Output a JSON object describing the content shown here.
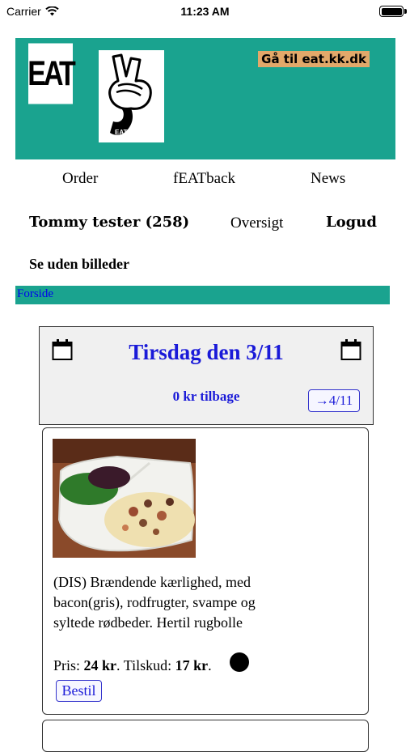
{
  "status_bar": {
    "carrier": "Carrier",
    "time": "11:23 AM",
    "wifi_icon": "wifi-icon",
    "battery_icon": "battery-icon",
    "battery_level": 1.0
  },
  "header": {
    "logo_text": "EAT",
    "mascot_text": "EAT",
    "external_link_label": "Gå til eat.kk.dk",
    "brand_color": "#1aa38f",
    "link_bg_color": "#e2a86a"
  },
  "nav": {
    "order_label": "Order",
    "feedback_label": "fEATback",
    "news_label": "News"
  },
  "user": {
    "name": "Tommy tester (258)",
    "overview_label": "Oversigt",
    "logout_label": "Logud",
    "no_images_label": "Se uden billeder"
  },
  "breadcrumb": {
    "home_label": "Forside"
  },
  "day": {
    "title": "Tirsdag den 3/11",
    "refund": "0 kr tilbage",
    "next_day_label": "→4/11",
    "calendar_icon": "calendar-icon",
    "accent_color": "#1a1ad8"
  },
  "meal": {
    "description": "(DIS) Brændende kærlighed, med bacon(gris), rodfrugter, svampe og syltede rødbeder. Hertil rugbolle",
    "price_label": "Pris:",
    "price_value": "24 kr",
    "subsidy_label": "Tilskud:",
    "subsidy_value": "17 kr",
    "order_label": "Bestil"
  }
}
